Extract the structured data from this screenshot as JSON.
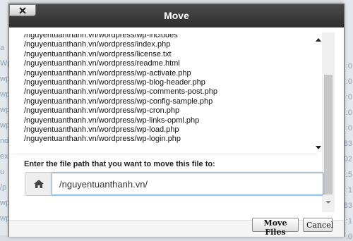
{
  "dialog": {
    "title": "Move",
    "close_label": "×"
  },
  "file_list": [
    "/nguyentuanthanh.vn/wordpress/wp-includes",
    "/nguyentuanthanh.vn/wordpress/index.php",
    "/nguyentuanthanh.vn/wordpress/license.txt",
    "/nguyentuanthanh.vn/wordpress/readme.html",
    "/nguyentuanthanh.vn/wordpress/wp-activate.php",
    "/nguyentuanthanh.vn/wordpress/wp-blog-header.php",
    "/nguyentuanthanh.vn/wordpress/wp-comments-post.php",
    "/nguyentuanthanh.vn/wordpress/wp-config-sample.php",
    "/nguyentuanthanh.vn/wordpress/wp-cron.php",
    "/nguyentuanthanh.vn/wordpress/wp-links-opml.php",
    "/nguyentuanthanh.vn/wordpress/wp-load.php",
    "/nguyentuanthanh.vn/wordpress/wp-login.php"
  ],
  "form": {
    "prompt": "Enter the file path that you want to move this file to:",
    "path_value": "/nguyentuanthanh.vn/"
  },
  "buttons": {
    "move": "Move Files",
    "cancel": "Cancel"
  },
  "background": {
    "left_fragments": [
      "a",
      "Wp",
      "wp",
      "wp",
      "wp",
      "wp",
      "nd",
      "ex",
      "u",
      "/p",
      "wp",
      "wp"
    ],
    "right_fragments": [
      ":0",
      ":0",
      ":0",
      ":0",
      ":0",
      "83",
      "02",
      ":5",
      ":1",
      "83",
      ":1",
      ":0"
    ]
  },
  "icons": {
    "close": "close-icon",
    "home": "home-icon",
    "scroll_up": "chevron-up-icon",
    "scroll_down": "chevron-down-icon"
  },
  "colors": {
    "titlebar": "#3a3a3a",
    "input_focus": "#7eb4ea"
  }
}
